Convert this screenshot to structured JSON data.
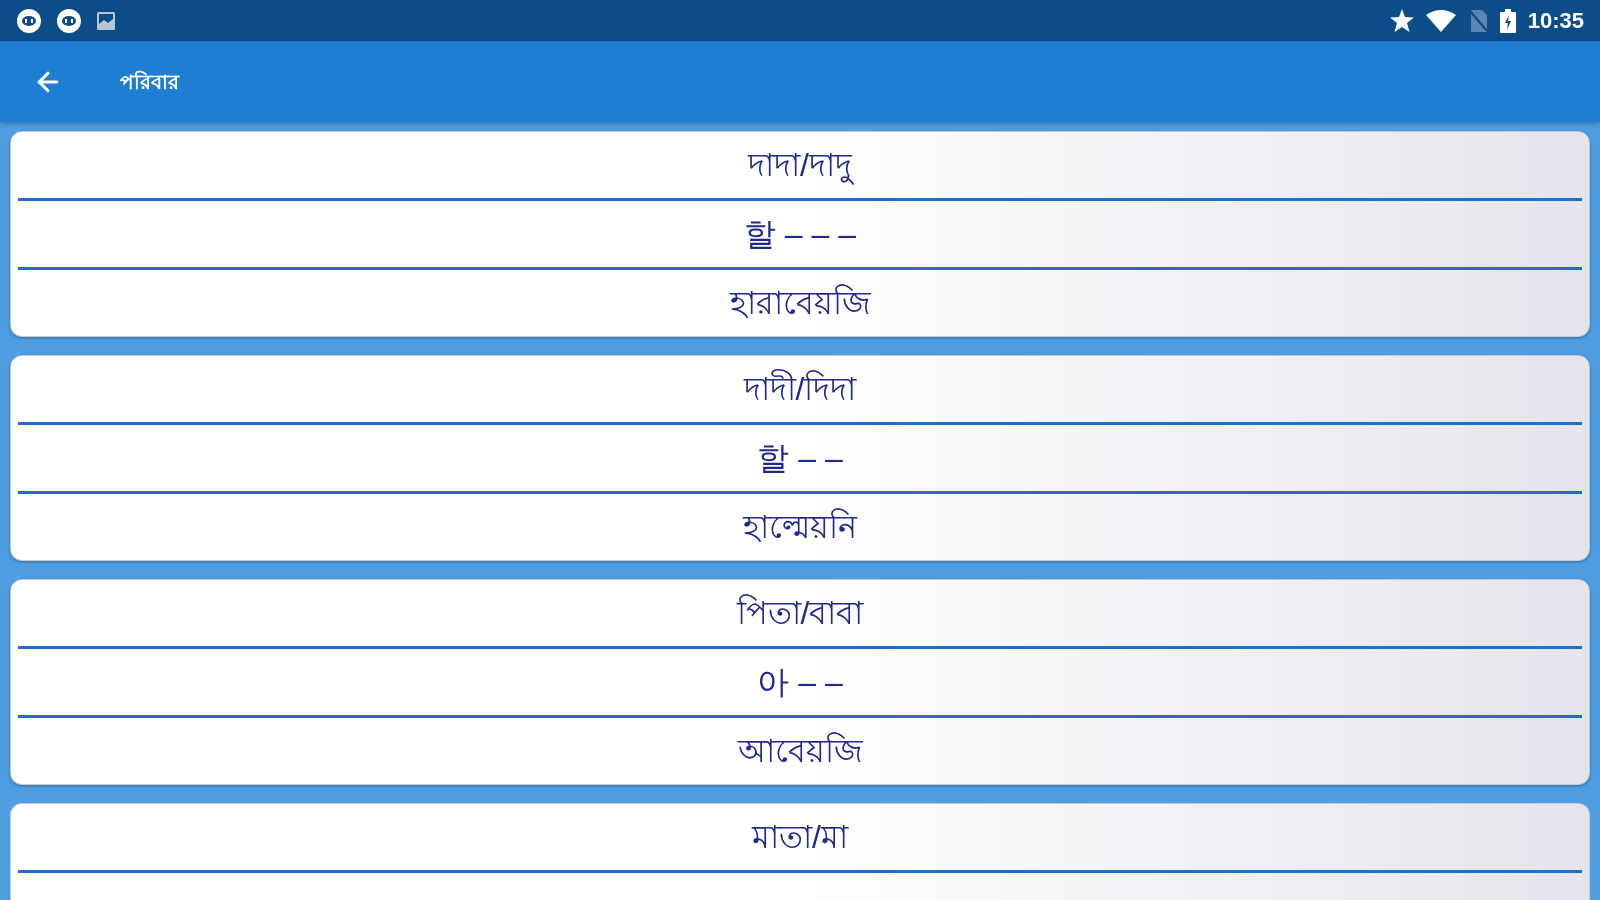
{
  "status_bar": {
    "time": "10:35"
  },
  "app_bar": {
    "title": "পরিবার"
  },
  "cards": [
    {
      "rows": [
        "দাদা/দাদু",
        "할 – – –",
        "হারাবেয়জি"
      ],
      "clipped": false
    },
    {
      "rows": [
        "দাদী/দিদা",
        "할 – –",
        "হাল্মেয়নি"
      ],
      "clipped": false
    },
    {
      "rows": [
        "পিতা/বাবা",
        "아 – –",
        "আবেয়জি"
      ],
      "clipped": false
    },
    {
      "rows": [
        "মাতা/মা"
      ],
      "clipped": true
    }
  ]
}
